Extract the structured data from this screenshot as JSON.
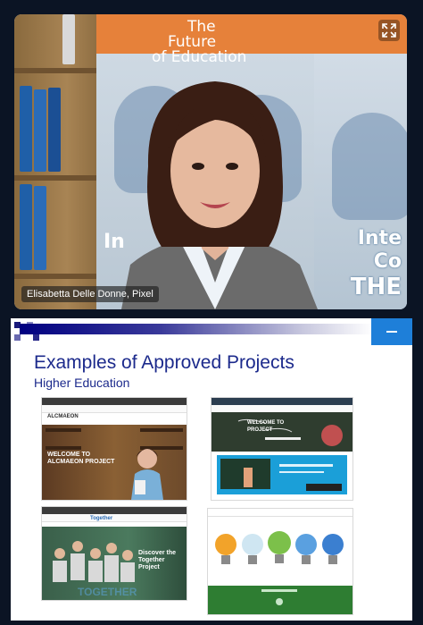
{
  "video": {
    "participant_name": "Elisabetta Delle Donne, Pixel",
    "banner_text": [
      "The",
      "Future",
      "of Education"
    ],
    "side_text": [
      "Inte",
      "Co",
      "THE"
    ],
    "left_text": "In",
    "expand_icon": "expand-icon"
  },
  "slide": {
    "title": "Examples of Approved Projects",
    "subtitle": "Higher Education",
    "minimize_icon": "minimize-icon",
    "thumbnails": [
      {
        "logo": "ALCMAEON",
        "hero_text": [
          "WELCOME TO",
          "ALCMAEON PROJECT"
        ]
      },
      {
        "hero_text": [
          "WELCOME TO",
          "PROJECT"
        ]
      },
      {
        "logo": "Together",
        "hero_text": [
          "Discover the",
          "Together Project"
        ],
        "footer": "TOGETHER"
      },
      {}
    ]
  }
}
